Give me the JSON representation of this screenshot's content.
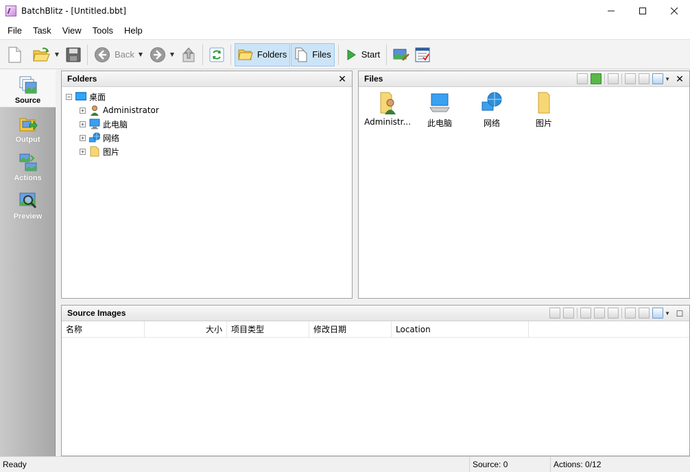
{
  "window": {
    "title": "BatchBlitz - [Untitled.bbt]",
    "controls": {
      "minimize": "─",
      "maximize": "☐",
      "close": "✕"
    }
  },
  "menu": [
    "File",
    "Task",
    "View",
    "Tools",
    "Help"
  ],
  "toolbar": {
    "back_label": "Back",
    "folders_label": "Folders",
    "files_label": "Files",
    "start_label": "Start"
  },
  "nav": {
    "items": [
      {
        "label": "Source",
        "icon": "source-icon",
        "active": true
      },
      {
        "label": "Output",
        "icon": "output-icon"
      },
      {
        "label": "Actions",
        "icon": "actions-icon"
      },
      {
        "label": "Preview",
        "icon": "preview-icon"
      }
    ]
  },
  "folders_panel": {
    "title": "Folders",
    "close": "✕",
    "tree": {
      "root": "桌面",
      "children": [
        "Administrator",
        "此电脑",
        "网络",
        "图片"
      ]
    }
  },
  "files_panel": {
    "title": "Files",
    "close": "✕",
    "items": [
      "Administr...",
      "此电脑",
      "网络",
      "图片"
    ]
  },
  "source_panel": {
    "title": "Source Images",
    "maximize": "□",
    "columns": [
      "名称",
      "大小",
      "项目类型",
      "修改日期",
      "Location"
    ]
  },
  "status": {
    "ready": "Ready",
    "source": "Source: 0",
    "actions": "Actions: 0/12"
  },
  "colors": {
    "accent": "#cce4f7",
    "nav_gradient_start": "#c9c9c9",
    "nav_gradient_end": "#a7a7a7",
    "folder": "#f7d774"
  }
}
